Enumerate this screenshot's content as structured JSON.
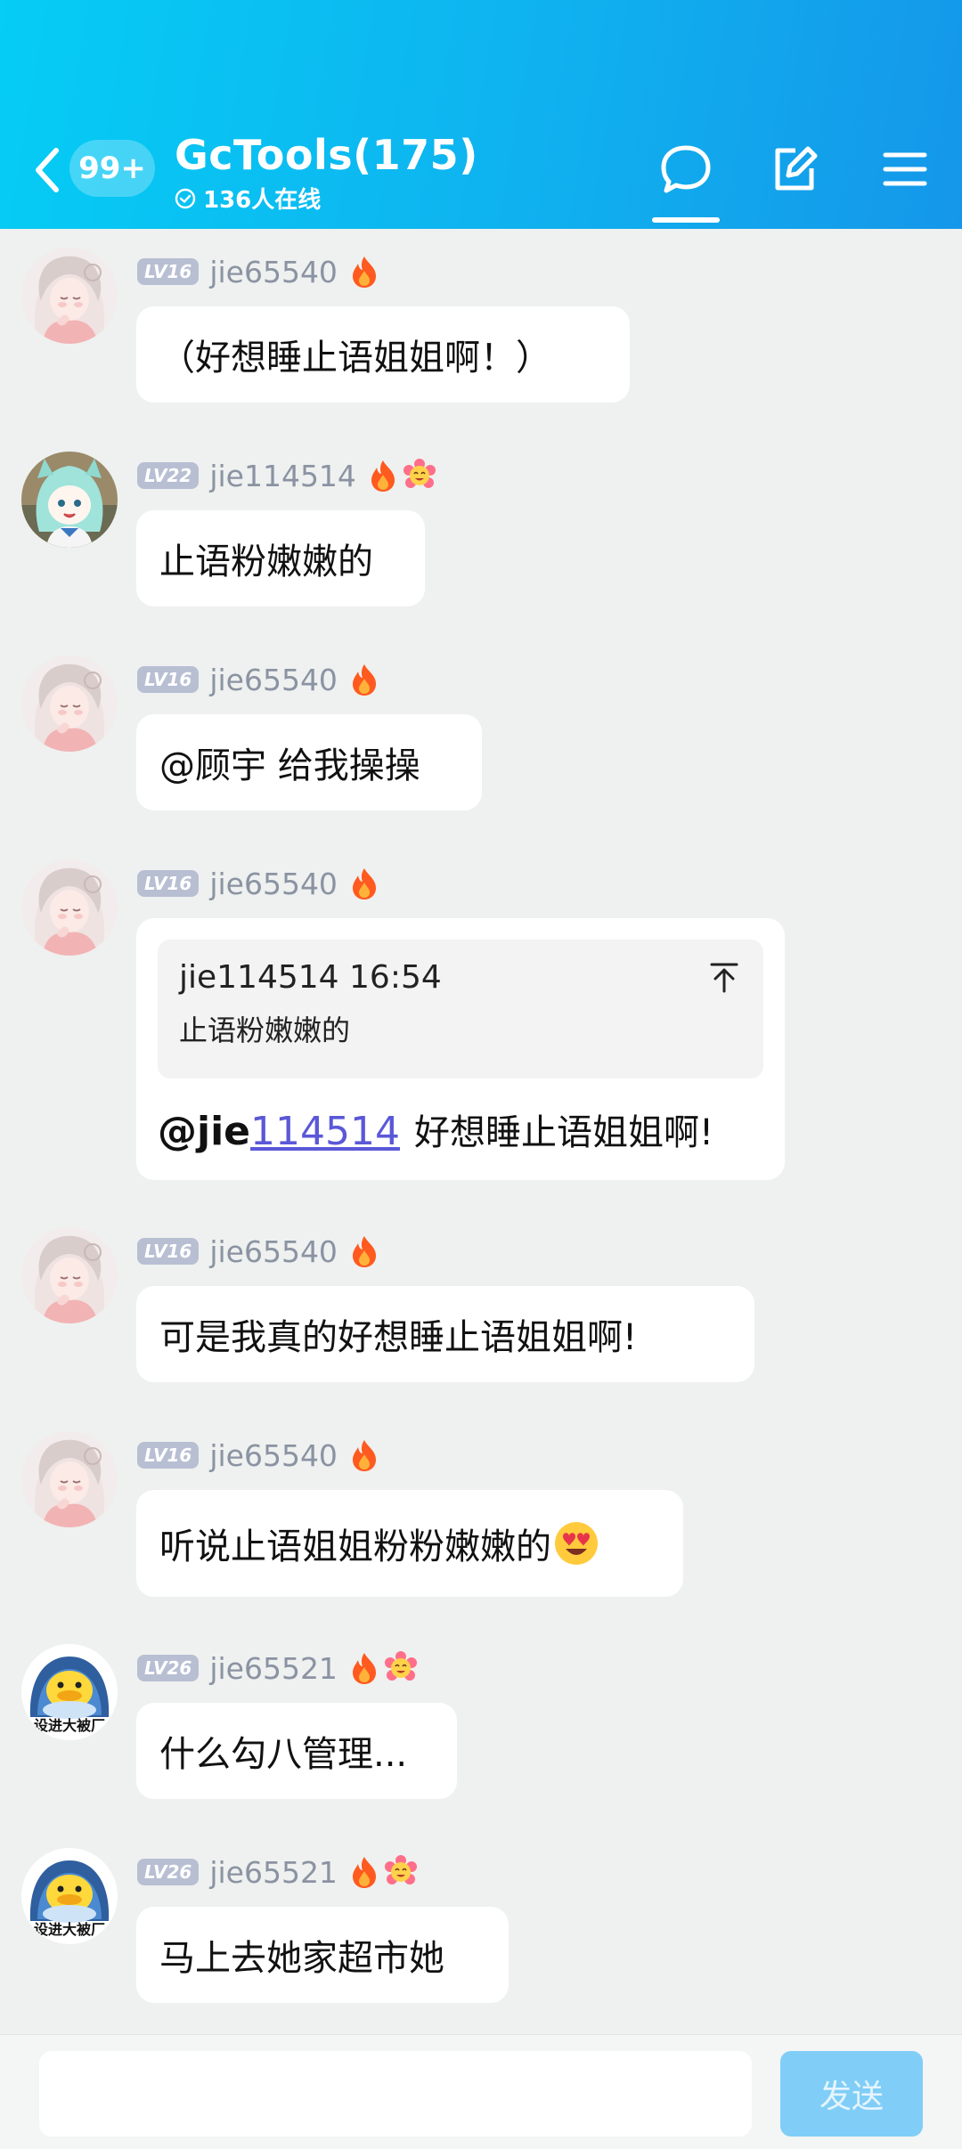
{
  "header": {
    "badge": "99+",
    "title": "GcTools(175)",
    "online": "136人在线"
  },
  "messages": [
    {
      "level": "LV16",
      "user": "jie65540",
      "text": "（好想睡止语姐姐啊！）",
      "avatar": "pink-hair-avatar",
      "emblems": [
        "fire-icon"
      ]
    },
    {
      "level": "LV22",
      "user": "jie114514",
      "text": "止语粉嫩嫩的",
      "avatar": "teal-hair-avatar",
      "emblems": [
        "fire-icon",
        "flower-emoji-icon"
      ]
    },
    {
      "level": "LV16",
      "user": "jie65540",
      "text": "@顾宇 给我操操",
      "avatar": "pink-hair-avatar",
      "emblems": [
        "fire-icon"
      ]
    },
    {
      "level": "LV16",
      "user": "jie65540",
      "quote": {
        "head": "jie114514 16:54",
        "body": "止语粉嫩嫩的",
        "prefix": "@jie",
        "link": "114514",
        "rest": "好想睡止语姐姐啊!"
      },
      "avatar": "pink-hair-avatar",
      "emblems": [
        "fire-icon"
      ]
    },
    {
      "level": "LV16",
      "user": "jie65540",
      "text": "可是我真的好想睡止语姐姐啊!",
      "avatar": "pink-hair-avatar",
      "emblems": [
        "fire-icon"
      ]
    },
    {
      "level": "LV16",
      "user": "jie65540",
      "text": "听说止语姐姐粉粉嫩嫩的",
      "avatar": "pink-hair-avatar",
      "emblems": [
        "fire-icon"
      ],
      "trailing_emoji": "heart-eyes-emoji"
    },
    {
      "level": "LV26",
      "user": "jie65521",
      "text": "什么勾八管理...",
      "avatar": "duck-avatar",
      "avatar_caption": "设进大被厂",
      "emblems": [
        "fire-icon",
        "flower-emoji-icon"
      ]
    },
    {
      "level": "LV26",
      "user": "jie65521",
      "text": "马上去她家超市她",
      "avatar": "duck-avatar",
      "avatar_caption": "设进大被厂",
      "emblems": [
        "fire-icon",
        "flower-emoji-icon"
      ]
    }
  ],
  "composer": {
    "placeholder": "",
    "send_label": "发送"
  },
  "colors": {
    "header_start": "#05cdf5",
    "header_end": "#1597e9",
    "link": "#5a58d8",
    "send_disabled": "#80cef7"
  }
}
